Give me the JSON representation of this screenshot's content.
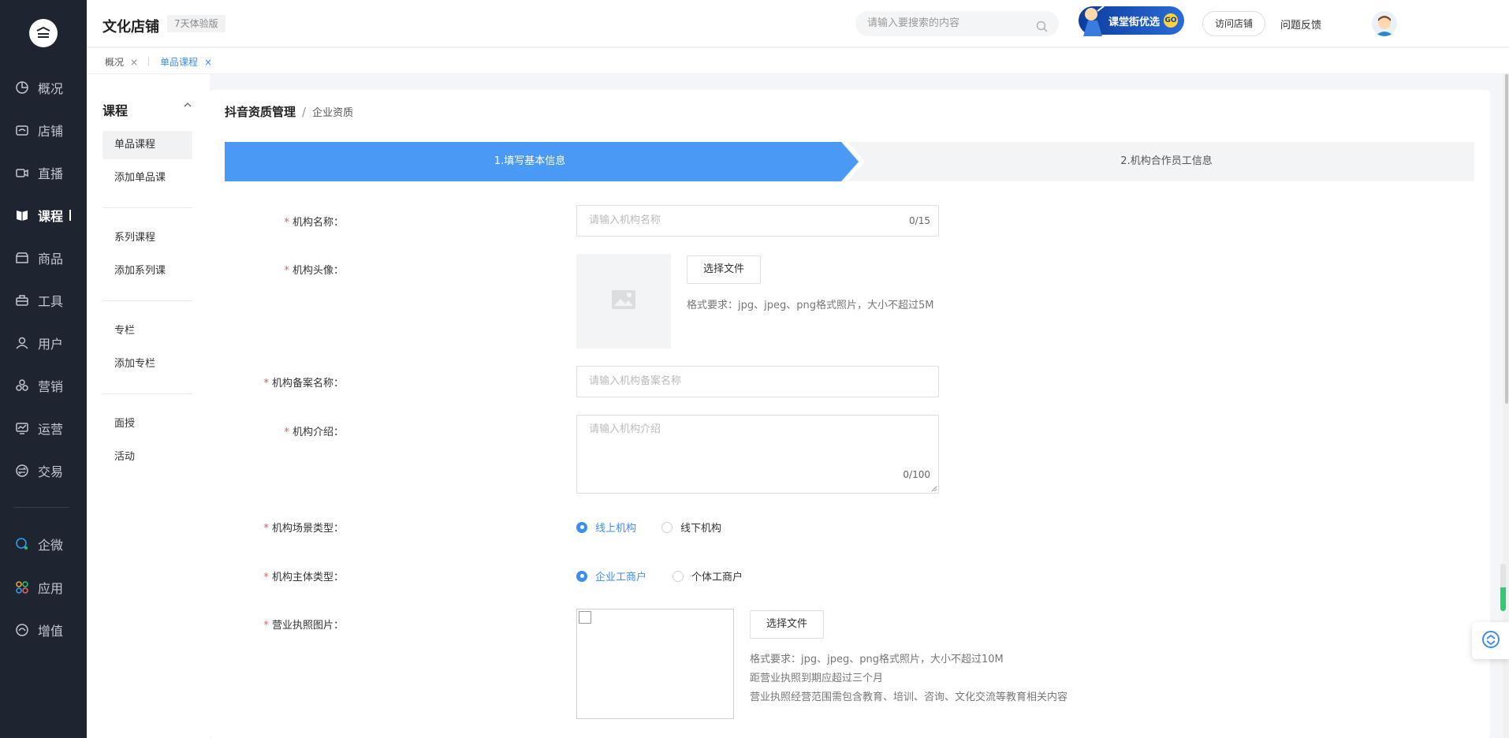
{
  "app": {
    "store_name": "文化店铺",
    "trial_badge": "7天体验版"
  },
  "nav": [
    {
      "label": "概况",
      "icon": "dashboard-icon"
    },
    {
      "label": "店铺",
      "icon": "store-icon"
    },
    {
      "label": "直播",
      "icon": "live-icon"
    },
    {
      "label": "课程",
      "icon": "course-book-icon"
    },
    {
      "label": "商品",
      "icon": "goods-icon"
    },
    {
      "label": "工具",
      "icon": "toolbox-icon"
    },
    {
      "label": "用户",
      "icon": "user-icon"
    },
    {
      "label": "营销",
      "icon": "marketing-icon"
    },
    {
      "label": "运营",
      "icon": "operation-icon"
    },
    {
      "label": "交易",
      "icon": "trade-icon"
    },
    {
      "label": "企微",
      "icon": "wecom-icon"
    },
    {
      "label": "应用",
      "icon": "apps-icon"
    },
    {
      "label": "增值",
      "icon": "value-added-icon"
    }
  ],
  "header": {
    "search_placeholder": "请输入要搜索的内容",
    "promo_text": "课堂街优选",
    "promo_go": "GO",
    "visit_store": "访问店铺",
    "feedback": "问题反馈"
  },
  "tabs": [
    {
      "label": "概况",
      "close": "×"
    },
    {
      "label": "单品课程",
      "close": "×"
    }
  ],
  "subnav": {
    "heading": "课程",
    "items": [
      "单品课程",
      "添加单品课",
      "系列课程",
      "添加系列课",
      "专栏",
      "添加专栏",
      "面授",
      "活动"
    ]
  },
  "breadcrumb": {
    "primary": "抖音资质管理",
    "separator": "/",
    "secondary": "企业资质"
  },
  "steps": [
    "1.填写基本信息",
    "2.机构合作员工信息"
  ],
  "form": {
    "required_mark": "*",
    "org_name": {
      "label": "机构名称：",
      "placeholder": "请输入机构名称",
      "counter": "0/15"
    },
    "org_avatar": {
      "label": "机构头像：",
      "button": "选择文件",
      "hint": "格式要求：jpg、jpeg、png格式照片，大小不超过5M"
    },
    "org_record_name": {
      "label": "机构备案名称：",
      "placeholder": "请输入机构备案名称"
    },
    "org_intro": {
      "label": "机构介绍：",
      "placeholder": "请输入机构介绍",
      "counter": "0/100"
    },
    "scene_type": {
      "label": "机构场景类型：",
      "options": [
        "线上机构",
        "线下机构"
      ],
      "selected": "线上机构"
    },
    "entity_type": {
      "label": "机构主体类型：",
      "options": [
        "企业工商户",
        "个体工商户"
      ],
      "selected": "企业工商户"
    },
    "license": {
      "label": "营业执照图片：",
      "button": "选择文件",
      "hints": [
        "格式要求：jpg、jpeg、png格式照片，大小不超过10M",
        "距营业执照到期应超过三个月",
        "营业执照经营范围需包含教育、培训、咨询、文化交流等教育相关内容"
      ]
    }
  },
  "colors": {
    "primary": "#4a9af5",
    "sidebar_bg": "#1f2431",
    "required": "#ff5555"
  },
  "scroll_gauge_level": 0.5
}
